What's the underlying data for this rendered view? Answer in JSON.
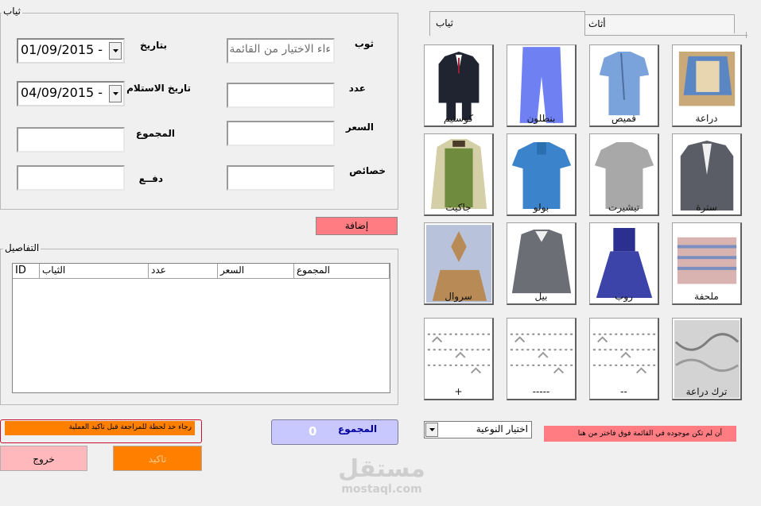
{
  "form": {
    "group_title": "ثياب",
    "labels": {
      "item": "ثوب",
      "count": "عدد",
      "price": "السعر",
      "features": "خصائص",
      "date": "بتاريخ",
      "receive_date": "تاريخ الاستلام",
      "total": "المجموع",
      "payment": "دفــع"
    },
    "item_placeholder": "ءاء الاختيار من القائمة",
    "date_value": "01/09/2015 -",
    "receive_date_value": "04/09/2015 -",
    "add_button": "إضافة"
  },
  "details": {
    "group_title": "التفاصيل",
    "columns": [
      "ID",
      "الثياب",
      "عدد",
      "السعر",
      "المجموع"
    ]
  },
  "footer": {
    "warning": "رجاء خذ لحظة للمراجعة قبل تاكيد العملية",
    "total_label": "المجموع",
    "total_value": "0",
    "exit_button": "خروج",
    "confirm_button": "تاكيد"
  },
  "tabs": [
    "ثياب",
    "أثاث"
  ],
  "tiles": [
    {
      "label": "دراعة",
      "icon": "daraa-icon"
    },
    {
      "label": "قميص",
      "icon": "shirt-icon"
    },
    {
      "label": "بنطلون",
      "icon": "trousers-icon"
    },
    {
      "label": "كوستيم",
      "icon": "suit-icon"
    },
    {
      "label": "سترة",
      "icon": "blazer-icon"
    },
    {
      "label": "تيشيرت",
      "icon": "tshirt-icon"
    },
    {
      "label": "بولو",
      "icon": "polo-icon"
    },
    {
      "label": "جاكيت",
      "icon": "jacket-icon"
    },
    {
      "label": "ملحفة",
      "icon": "melhfa-icon"
    },
    {
      "label": "روب",
      "icon": "dress-icon"
    },
    {
      "label": "بيل",
      "icon": "sweater-icon"
    },
    {
      "label": "سروال",
      "icon": "serwal-icon"
    },
    {
      "label": "ترك دراعة",
      "icon": "embroidery-icon"
    },
    {
      "label": "--",
      "icon": "pattern-icon"
    },
    {
      "label": "-----",
      "icon": "pattern-icon"
    },
    {
      "label": "+",
      "icon": "pattern-icon"
    }
  ],
  "type_select": {
    "value": "اختيار النوعية"
  },
  "hint": "أن لم تكن موجوده في القائمة فوق فاختر من هنا",
  "watermark": {
    "arabic": "مستقل",
    "latin": "mostaql.com"
  },
  "colors": {
    "background": "#f0f0f0",
    "pink": "#ff7d82",
    "orange": "#ff8000",
    "total_box": "#c8c8ff",
    "total_text": "#0000a0"
  }
}
